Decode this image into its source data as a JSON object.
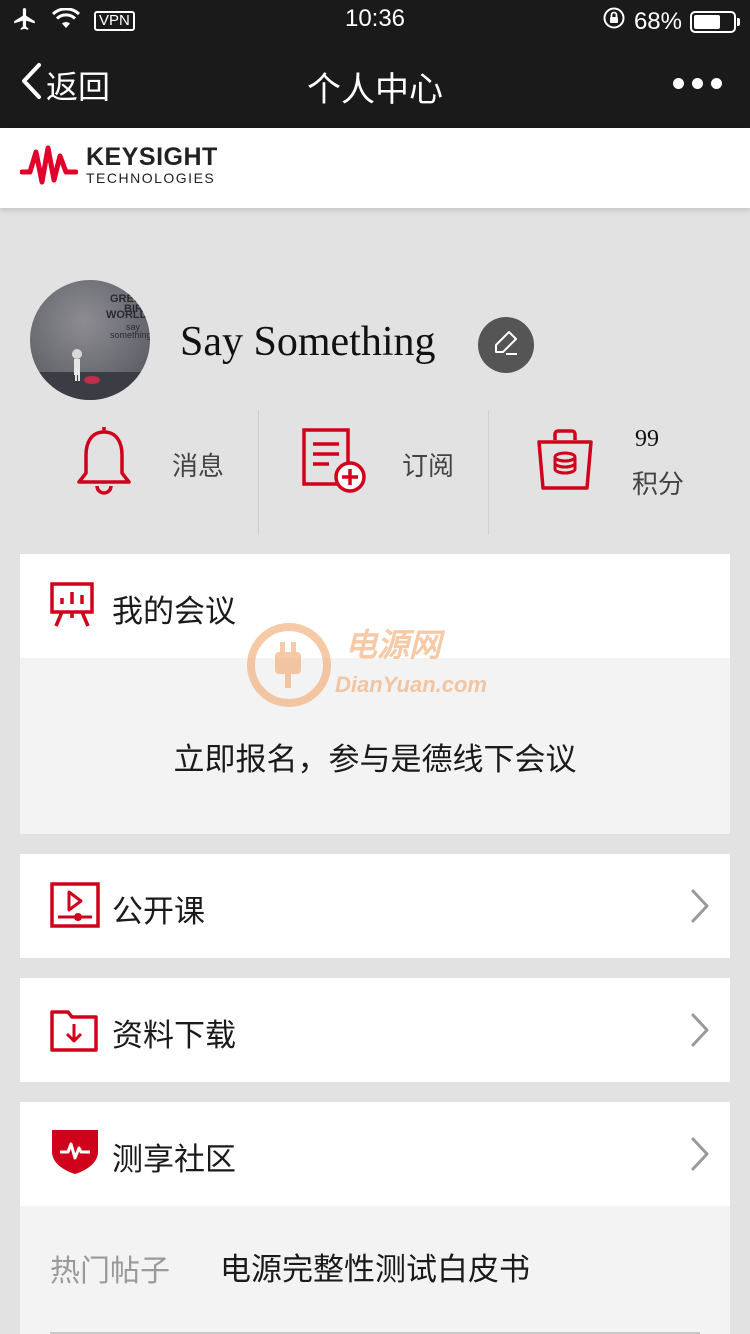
{
  "status_bar": {
    "time": "10:36",
    "vpn": "VPN",
    "battery": "68%",
    "battery_level": 0.68
  },
  "nav": {
    "back_label": "返回",
    "title": "个人中心"
  },
  "brand": {
    "name": "KEYSIGHT",
    "sub": "TECHNOLOGIES",
    "color": "#e1002a"
  },
  "profile": {
    "avatar_text": [
      "GREEN",
      "BIRD",
      "WORLD",
      "say",
      "something"
    ],
    "username": "Say Something"
  },
  "stats": {
    "messages_label": "消息",
    "subscriptions_label": "订阅",
    "points_count": "99",
    "points_label": "积分"
  },
  "sections": {
    "meeting": {
      "title": "我的会议",
      "cta": "立即报名，参与是德线下会议"
    },
    "course": {
      "title": "公开课"
    },
    "download": {
      "title": "资料下载"
    },
    "community": {
      "title": "测享社区",
      "hot_label": "热门帖子",
      "hot_post": "电源完整性测试白皮书"
    }
  },
  "watermark": {
    "cn": "电源网",
    "en": "DianYuan.com"
  },
  "accent_color": "#d0021b"
}
